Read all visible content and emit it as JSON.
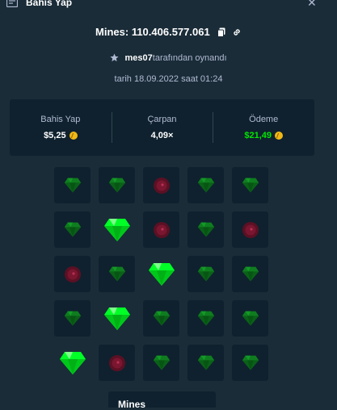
{
  "header": {
    "title": "Bahis Yap"
  },
  "game": {
    "id_text": "Mines: 110.406.577.061",
    "username": "mes07",
    "played_suffix": "tarafından oynandı",
    "date_text": "tarih 18.09.2022 saat 01:24"
  },
  "stats": {
    "bet_label": "Bahis Yap",
    "bet_value": "$5,25",
    "multiplier_label": "Çarpan",
    "multiplier_value": "4,09×",
    "payout_label": "Ödeme",
    "payout_value": "$21,49"
  },
  "colors": {
    "background": "#1a2c38",
    "panel": "#0f212e",
    "payout_green": "#00e701",
    "gem_green": "#00e701",
    "mine_red": "#e9113c"
  },
  "grid": {
    "rows": [
      [
        "gem",
        "gem",
        "mine",
        "gem",
        "gem"
      ],
      [
        "gem",
        "gem-picked",
        "mine",
        "gem",
        "mine"
      ],
      [
        "mine",
        "gem",
        "gem-picked",
        "gem",
        "gem"
      ],
      [
        "gem",
        "gem-picked",
        "gem",
        "gem",
        "gem"
      ],
      [
        "gem-picked",
        "mine",
        "gem",
        "gem",
        "gem"
      ]
    ]
  },
  "bottom": {
    "tab_label": "Mines"
  }
}
